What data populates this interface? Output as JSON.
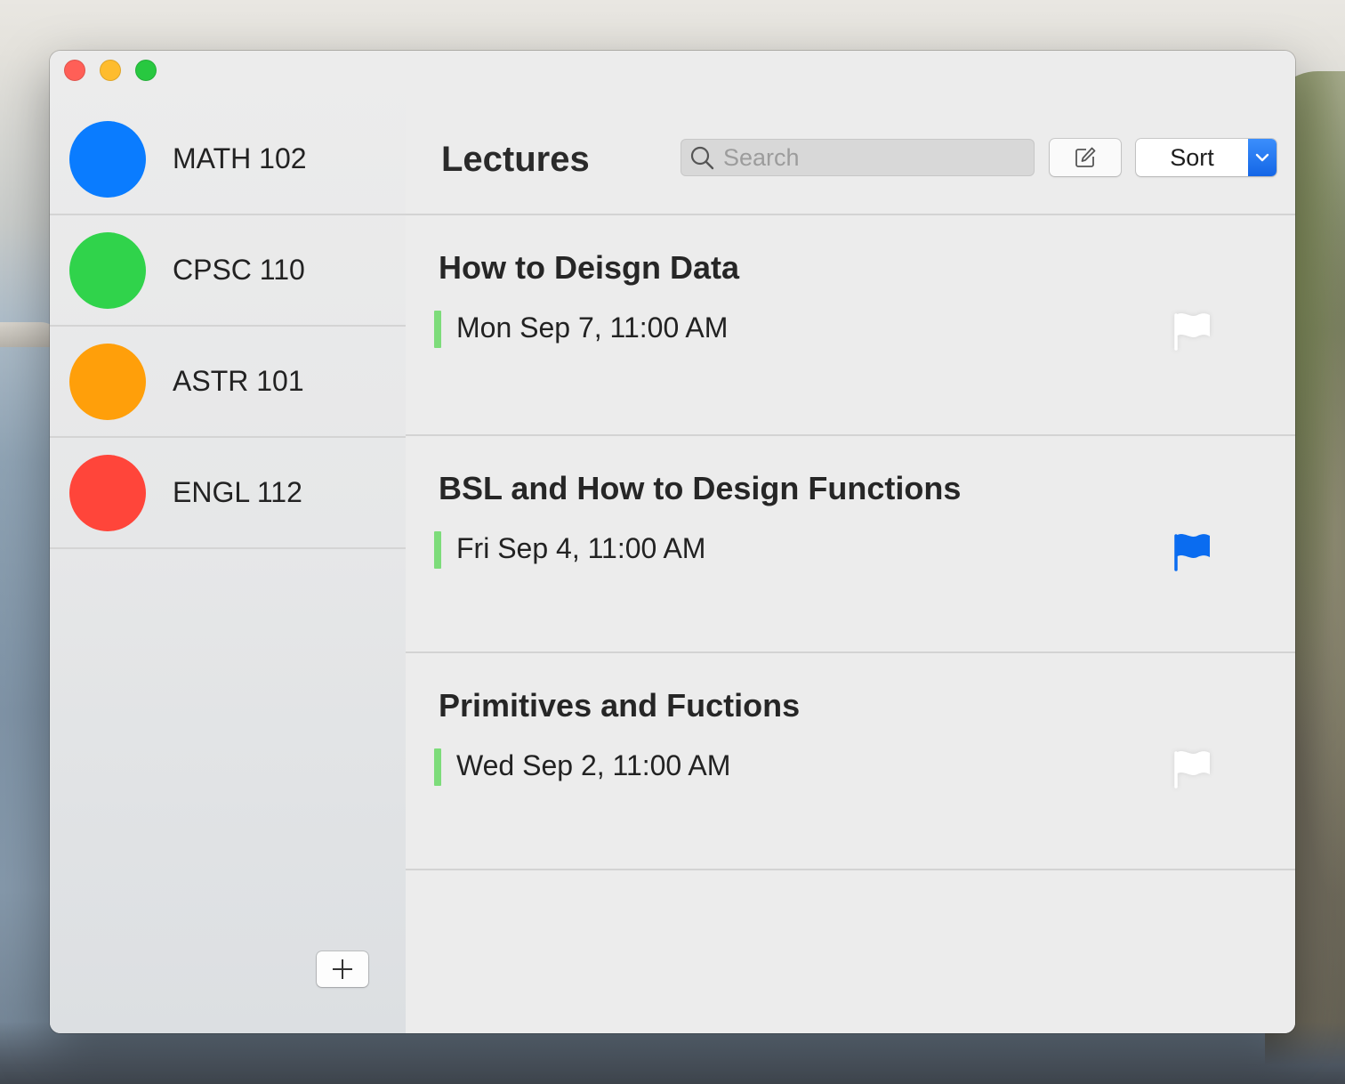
{
  "window": {
    "traffic_lights": [
      "close",
      "minimize",
      "zoom"
    ]
  },
  "sidebar": {
    "courses": [
      {
        "label": "MATH 102",
        "color": "#0a7cff"
      },
      {
        "label": "CPSC 110",
        "color": "#30d34b"
      },
      {
        "label": "ASTR 101",
        "color": "#ff9f0a"
      },
      {
        "label": "ENGL 112",
        "color": "#ff453a"
      }
    ],
    "add_button_label": "+"
  },
  "toolbar": {
    "title": "Lectures",
    "search_placeholder": "Search",
    "search_value": "",
    "compose_icon": "compose-icon",
    "sort_label": "Sort",
    "accent_color": "#1a6cf0"
  },
  "lectures": [
    {
      "title": "How to Deisgn Data",
      "date": "Mon Sep 7, 11:00 AM",
      "flagged": false
    },
    {
      "title": "BSL and How to Design Functions",
      "date": "Fri Sep 4, 11:00 AM",
      "flagged": true
    },
    {
      "title": "Primitives and Fuctions",
      "date": "Wed Sep 2, 11:00 AM",
      "flagged": false
    }
  ],
  "colors": {
    "flag_active": "#0a6cf0",
    "flag_inactive": "#ffffff",
    "date_marker": "#7ddc7a"
  }
}
